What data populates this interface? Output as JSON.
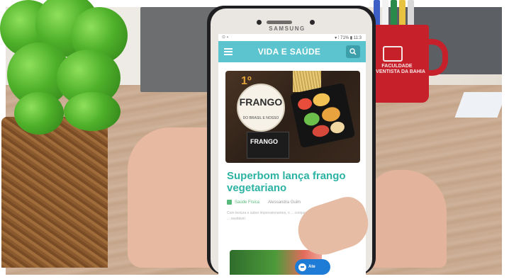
{
  "phone": {
    "brand": "SAMSUNG"
  },
  "statusbar": {
    "left": "⊙ ▪",
    "right": "▾ ⁞ 71% ▮ 11:3"
  },
  "app": {
    "logo": "VIDA E SAÚDE",
    "menu_icon": "hamburger-icon",
    "search_icon": "search-icon"
  },
  "article": {
    "hero_number": "1º",
    "hero_title": "FRANGO",
    "hero_subtitle": "DO BRASIL E NOSSO",
    "hero_package": "FRANGO",
    "headline": "Superbom lança frango vegetariano",
    "category": "Saúde Física",
    "author": "Alessandra Guim",
    "excerpt": "Com textura e sabor impressionantes, o ... conquistado o coração de quem busca ... saudável."
  },
  "chat": {
    "label": "Ate"
  },
  "mug": {
    "text": "FACULDADE ADVENTISTA DA BAHIA"
  },
  "colors": {
    "appbar": "#5bc4cf",
    "headline": "#2bb2a3",
    "category": "#57b97a",
    "chat_button": "#1e7bd6"
  }
}
